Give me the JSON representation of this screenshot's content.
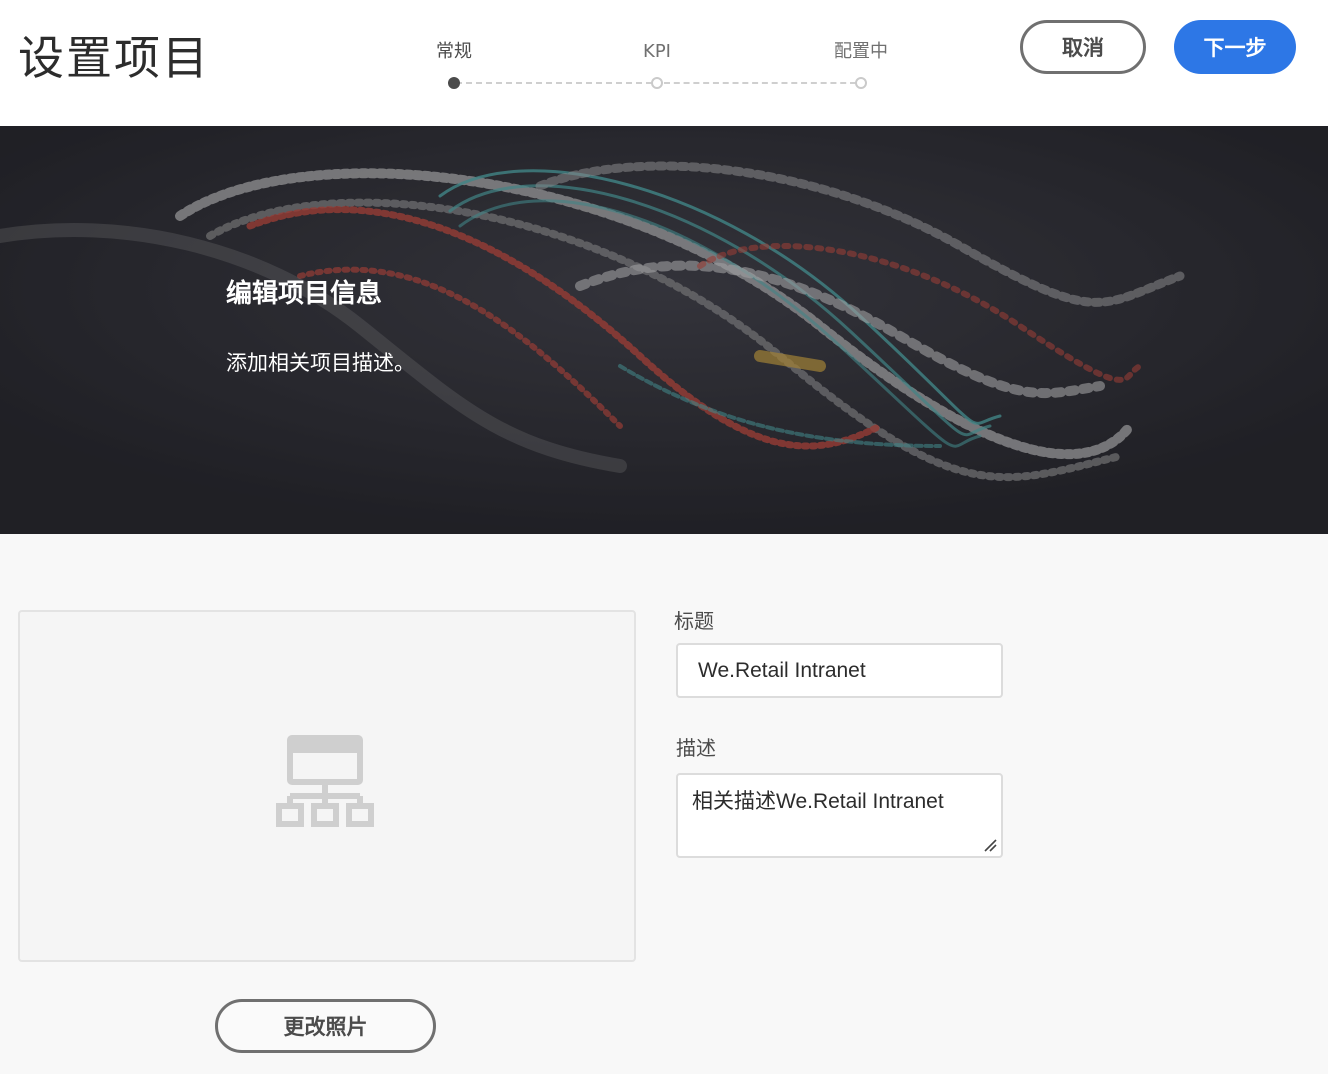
{
  "header": {
    "title": "设置项目",
    "steps": [
      {
        "label": "常规",
        "state": "done"
      },
      {
        "label": "KPI",
        "state": "todo"
      },
      {
        "label": "配置中",
        "state": "todo"
      }
    ],
    "cancel_label": "取消",
    "next_label": "下一步"
  },
  "hero": {
    "title": "编辑项目信息",
    "subtitle": "添加相关项目描述。"
  },
  "form": {
    "change_photo_label": "更改照片",
    "title_label": "标题",
    "title_value": "We.Retail Intranet",
    "description_label": "描述",
    "description_value": "相关描述We.Retail Intranet"
  },
  "colors": {
    "primary": "#2d77e6",
    "hero_bg": "#1f1f24",
    "accent_red": "#d2473a",
    "accent_teal": "#4fb6b5"
  },
  "icons": {
    "thumbnail": "site-structure-icon",
    "resize": "resize-handle-icon"
  }
}
